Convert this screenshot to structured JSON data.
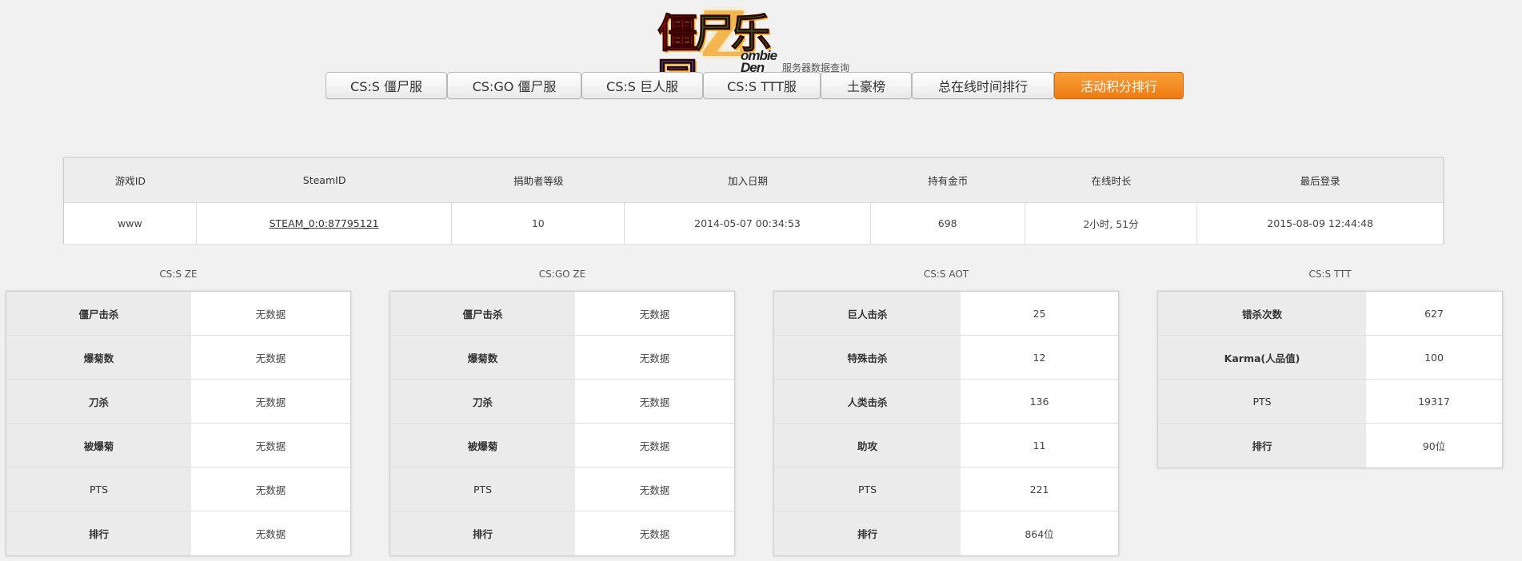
{
  "logo": {
    "main_part1": "僵",
    "main_part2": "尸",
    "main_part3": "乐",
    "main_part4": "园",
    "z_letter": "Z",
    "en_line1": "ombie",
    "en_line2": "Den",
    "subtitle": "服务器数据查询"
  },
  "nav": {
    "items": [
      {
        "label": "CS:S 僵尸服",
        "active": false
      },
      {
        "label": "CS:GO 僵尸服",
        "active": false
      },
      {
        "label": "CS:S 巨人服",
        "active": false
      },
      {
        "label": "CS:S TTT服",
        "active": false
      },
      {
        "label": "土豪榜",
        "active": false
      },
      {
        "label": "总在线时间排行",
        "active": false
      },
      {
        "label": "活动积分排行",
        "active": true
      }
    ]
  },
  "info": {
    "headers": [
      "游戏ID",
      "SteamID",
      "捐助者等级",
      "加入日期",
      "持有金币",
      "在线时长",
      "最后登录"
    ],
    "row": [
      "www",
      "STEAM_0:0:87795121",
      "10",
      "2014-05-07 00:34:53",
      "698",
      "2小时, 51分",
      "2015-08-09 12:44:48"
    ]
  },
  "panels": [
    {
      "title": "CS:S ZE",
      "rows": [
        {
          "key": "僵尸击杀",
          "value": "无数据"
        },
        {
          "key": "爆菊数",
          "value": "无数据"
        },
        {
          "key": "刀杀",
          "value": "无数据"
        },
        {
          "key": "被爆菊",
          "value": "无数据"
        },
        {
          "key": "PTS",
          "value": "无数据"
        },
        {
          "key": "排行",
          "value": "无数据"
        }
      ]
    },
    {
      "title": "CS:GO ZE",
      "rows": [
        {
          "key": "僵尸击杀",
          "value": "无数据"
        },
        {
          "key": "爆菊数",
          "value": "无数据"
        },
        {
          "key": "刀杀",
          "value": "无数据"
        },
        {
          "key": "被爆菊",
          "value": "无数据"
        },
        {
          "key": "PTS",
          "value": "无数据"
        },
        {
          "key": "排行",
          "value": "无数据"
        }
      ]
    },
    {
      "title": "CS:S AOT",
      "rows": [
        {
          "key": "巨人击杀",
          "value": "25"
        },
        {
          "key": "特殊击杀",
          "value": "12"
        },
        {
          "key": "人类击杀",
          "value": "136"
        },
        {
          "key": "助攻",
          "value": "11"
        },
        {
          "key": "PTS",
          "value": "221"
        },
        {
          "key": "排行",
          "value": "864位"
        }
      ]
    },
    {
      "title": "CS:S TTT",
      "rows": [
        {
          "key": "错杀次数",
          "value": "627"
        },
        {
          "key": "Karma(人品值)",
          "value": "100"
        },
        {
          "key": "PTS",
          "value": "19317"
        },
        {
          "key": "排行",
          "value": "90位"
        }
      ]
    }
  ],
  "colors": {
    "accent": "#f28c1e",
    "page_bg": "#f1f1f1"
  }
}
